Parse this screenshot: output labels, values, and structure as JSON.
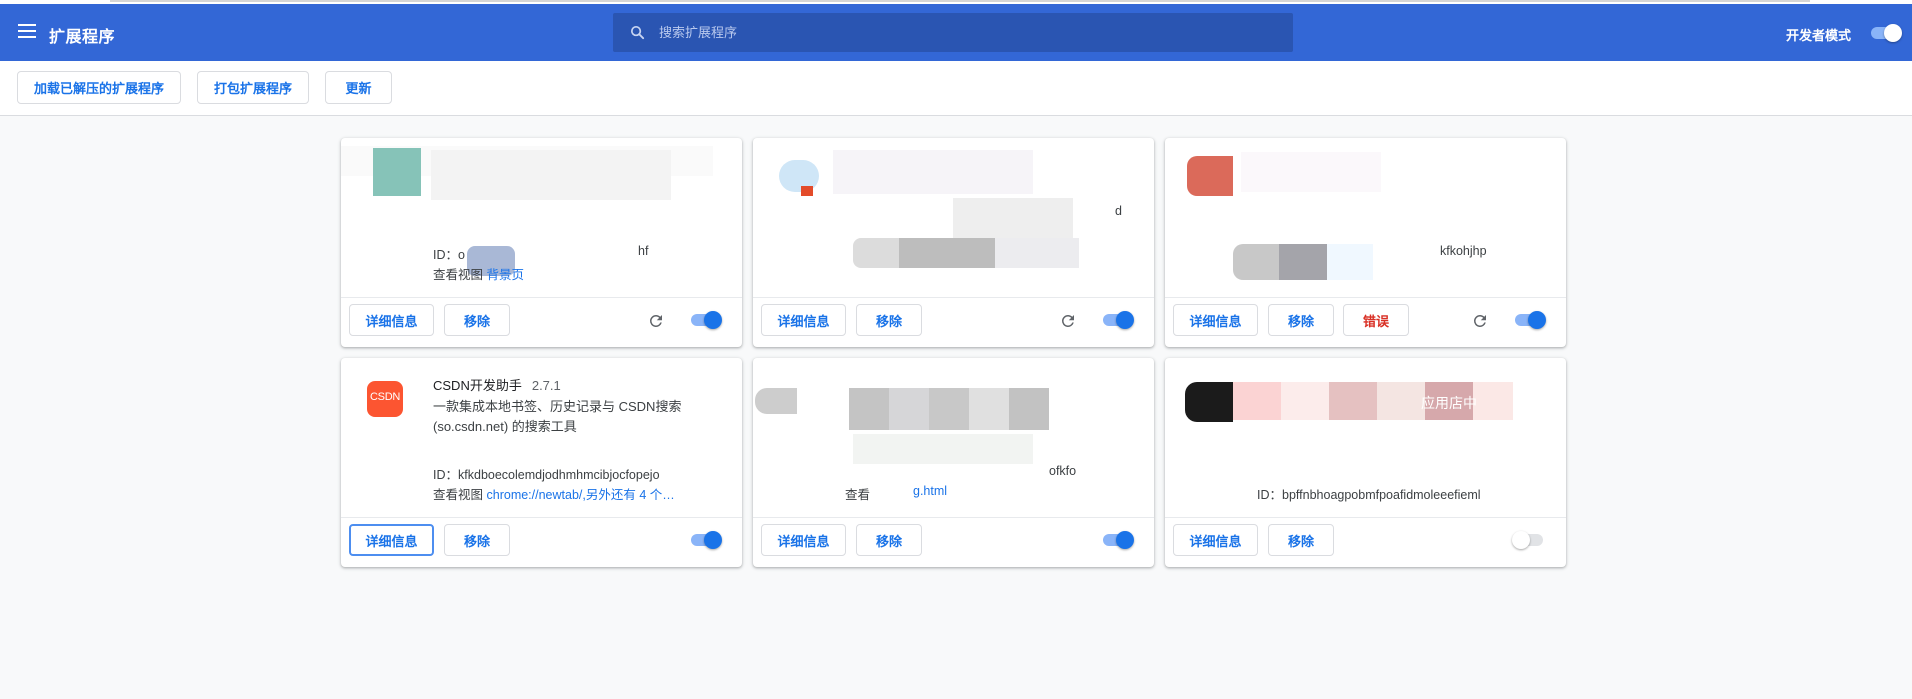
{
  "header": {
    "title": "扩展程序",
    "search_placeholder": "搜索扩展程序",
    "devmode_label": "开发者模式",
    "devmode_on": true
  },
  "toolbar": {
    "load_unpacked": "加载已解压的扩展程序",
    "pack": "打包扩展程序",
    "update": "更新"
  },
  "cards": [
    {
      "id_label": "ID：",
      "id_prefix": "o",
      "id_suffix": "hf",
      "view_label": "查看视图",
      "view_link": "背景页",
      "details": "详细信息",
      "remove": "移除",
      "enabled": true
    },
    {
      "id_suffix": "d",
      "details": "详细信息",
      "remove": "移除",
      "enabled": true
    },
    {
      "id_suffix": "kfkohjhp",
      "details": "详细信息",
      "remove": "移除",
      "error": "错误",
      "enabled": true
    },
    {
      "name": "CSDN开发助手",
      "version": "2.7.1",
      "description": "一款集成本地书签、历史记录与 CSDN搜索(so.csdn.net) 的搜索工具",
      "logo_text": "CSDN",
      "id_label": "ID：",
      "id": "kfkdboecolemdjodhmhmcibjocfopejo",
      "view_label": "查看视图",
      "view_link": "chrome://newtab/,另外还有 4 个…",
      "details": "详细信息",
      "remove": "移除",
      "enabled": true
    },
    {
      "id_suffix": "ofkfo",
      "view_label": "查看",
      "view_link": "g.html",
      "details": "详细信息",
      "remove": "移除",
      "enabled": true
    },
    {
      "desc_fragment": "应用店中",
      "id_label": "ID：",
      "id": "bpffnbhoagpobmfpoafidmoleeefieml",
      "details": "详细信息",
      "remove": "移除",
      "enabled": false
    }
  ],
  "colors": {
    "header_bg": "#3367d6",
    "search_bg": "#2a55b2",
    "accent": "#1a73e8",
    "error": "#d93025",
    "csdn_brand": "#fc5531"
  }
}
